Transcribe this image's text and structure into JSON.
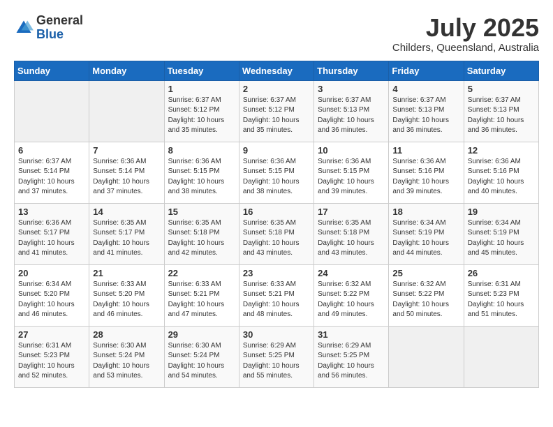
{
  "header": {
    "logo_general": "General",
    "logo_blue": "Blue",
    "month_title": "July 2025",
    "location": "Childers, Queensland, Australia"
  },
  "days_of_week": [
    "Sunday",
    "Monday",
    "Tuesday",
    "Wednesday",
    "Thursday",
    "Friday",
    "Saturday"
  ],
  "weeks": [
    [
      {
        "day": "",
        "details": ""
      },
      {
        "day": "",
        "details": ""
      },
      {
        "day": "1",
        "details": "Sunrise: 6:37 AM\nSunset: 5:12 PM\nDaylight: 10 hours and 35 minutes."
      },
      {
        "day": "2",
        "details": "Sunrise: 6:37 AM\nSunset: 5:12 PM\nDaylight: 10 hours and 35 minutes."
      },
      {
        "day": "3",
        "details": "Sunrise: 6:37 AM\nSunset: 5:13 PM\nDaylight: 10 hours and 36 minutes."
      },
      {
        "day": "4",
        "details": "Sunrise: 6:37 AM\nSunset: 5:13 PM\nDaylight: 10 hours and 36 minutes."
      },
      {
        "day": "5",
        "details": "Sunrise: 6:37 AM\nSunset: 5:13 PM\nDaylight: 10 hours and 36 minutes."
      }
    ],
    [
      {
        "day": "6",
        "details": "Sunrise: 6:37 AM\nSunset: 5:14 PM\nDaylight: 10 hours and 37 minutes."
      },
      {
        "day": "7",
        "details": "Sunrise: 6:36 AM\nSunset: 5:14 PM\nDaylight: 10 hours and 37 minutes."
      },
      {
        "day": "8",
        "details": "Sunrise: 6:36 AM\nSunset: 5:15 PM\nDaylight: 10 hours and 38 minutes."
      },
      {
        "day": "9",
        "details": "Sunrise: 6:36 AM\nSunset: 5:15 PM\nDaylight: 10 hours and 38 minutes."
      },
      {
        "day": "10",
        "details": "Sunrise: 6:36 AM\nSunset: 5:15 PM\nDaylight: 10 hours and 39 minutes."
      },
      {
        "day": "11",
        "details": "Sunrise: 6:36 AM\nSunset: 5:16 PM\nDaylight: 10 hours and 39 minutes."
      },
      {
        "day": "12",
        "details": "Sunrise: 6:36 AM\nSunset: 5:16 PM\nDaylight: 10 hours and 40 minutes."
      }
    ],
    [
      {
        "day": "13",
        "details": "Sunrise: 6:36 AM\nSunset: 5:17 PM\nDaylight: 10 hours and 41 minutes."
      },
      {
        "day": "14",
        "details": "Sunrise: 6:35 AM\nSunset: 5:17 PM\nDaylight: 10 hours and 41 minutes."
      },
      {
        "day": "15",
        "details": "Sunrise: 6:35 AM\nSunset: 5:18 PM\nDaylight: 10 hours and 42 minutes."
      },
      {
        "day": "16",
        "details": "Sunrise: 6:35 AM\nSunset: 5:18 PM\nDaylight: 10 hours and 43 minutes."
      },
      {
        "day": "17",
        "details": "Sunrise: 6:35 AM\nSunset: 5:18 PM\nDaylight: 10 hours and 43 minutes."
      },
      {
        "day": "18",
        "details": "Sunrise: 6:34 AM\nSunset: 5:19 PM\nDaylight: 10 hours and 44 minutes."
      },
      {
        "day": "19",
        "details": "Sunrise: 6:34 AM\nSunset: 5:19 PM\nDaylight: 10 hours and 45 minutes."
      }
    ],
    [
      {
        "day": "20",
        "details": "Sunrise: 6:34 AM\nSunset: 5:20 PM\nDaylight: 10 hours and 46 minutes."
      },
      {
        "day": "21",
        "details": "Sunrise: 6:33 AM\nSunset: 5:20 PM\nDaylight: 10 hours and 46 minutes."
      },
      {
        "day": "22",
        "details": "Sunrise: 6:33 AM\nSunset: 5:21 PM\nDaylight: 10 hours and 47 minutes."
      },
      {
        "day": "23",
        "details": "Sunrise: 6:33 AM\nSunset: 5:21 PM\nDaylight: 10 hours and 48 minutes."
      },
      {
        "day": "24",
        "details": "Sunrise: 6:32 AM\nSunset: 5:22 PM\nDaylight: 10 hours and 49 minutes."
      },
      {
        "day": "25",
        "details": "Sunrise: 6:32 AM\nSunset: 5:22 PM\nDaylight: 10 hours and 50 minutes."
      },
      {
        "day": "26",
        "details": "Sunrise: 6:31 AM\nSunset: 5:23 PM\nDaylight: 10 hours and 51 minutes."
      }
    ],
    [
      {
        "day": "27",
        "details": "Sunrise: 6:31 AM\nSunset: 5:23 PM\nDaylight: 10 hours and 52 minutes."
      },
      {
        "day": "28",
        "details": "Sunrise: 6:30 AM\nSunset: 5:24 PM\nDaylight: 10 hours and 53 minutes."
      },
      {
        "day": "29",
        "details": "Sunrise: 6:30 AM\nSunset: 5:24 PM\nDaylight: 10 hours and 54 minutes."
      },
      {
        "day": "30",
        "details": "Sunrise: 6:29 AM\nSunset: 5:25 PM\nDaylight: 10 hours and 55 minutes."
      },
      {
        "day": "31",
        "details": "Sunrise: 6:29 AM\nSunset: 5:25 PM\nDaylight: 10 hours and 56 minutes."
      },
      {
        "day": "",
        "details": ""
      },
      {
        "day": "",
        "details": ""
      }
    ]
  ]
}
